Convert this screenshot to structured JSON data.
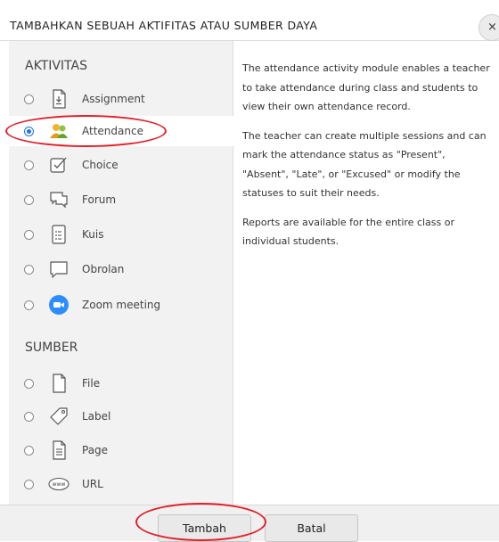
{
  "dialog": {
    "title": "TAMBAHKAN SEBUAH AKTIFITAS ATAU SUMBER DAYA",
    "close_label": "×"
  },
  "activities": {
    "heading": "AKTIVITAS",
    "items": [
      {
        "label": "Assignment",
        "icon": "assignment-icon",
        "selected": false
      },
      {
        "label": "Attendance",
        "icon": "attendance-icon",
        "selected": true
      },
      {
        "label": "Choice",
        "icon": "choice-icon",
        "selected": false
      },
      {
        "label": "Forum",
        "icon": "forum-icon",
        "selected": false
      },
      {
        "label": "Kuis",
        "icon": "quiz-icon",
        "selected": false
      },
      {
        "label": "Obrolan",
        "icon": "chat-icon",
        "selected": false
      },
      {
        "label": "Zoom meeting",
        "icon": "zoom-icon",
        "selected": false
      }
    ]
  },
  "resources": {
    "heading": "SUMBER",
    "items": [
      {
        "label": "File",
        "icon": "file-icon"
      },
      {
        "label": "Label",
        "icon": "label-icon"
      },
      {
        "label": "Page",
        "icon": "page-icon"
      },
      {
        "label": "URL",
        "icon": "url-icon",
        "icon_text": "www"
      }
    ]
  },
  "description": {
    "p1": "The attendance activity module enables a teacher to take attendance during class and students to view their own attendance record.",
    "p2": "The teacher can create multiple sessions and can mark the attendance status as \"Present\", \"Absent\", \"Late\", or \"Excused\" or modify the statuses to suit their needs.",
    "p3": "Reports are available for the entire class or individual students."
  },
  "footer": {
    "add_label": "Tambah",
    "cancel_label": "Batal"
  },
  "colors": {
    "annotation": "#e0202a",
    "radio_selected": "#1a73e8",
    "zoom_blue": "#2d8cff"
  }
}
